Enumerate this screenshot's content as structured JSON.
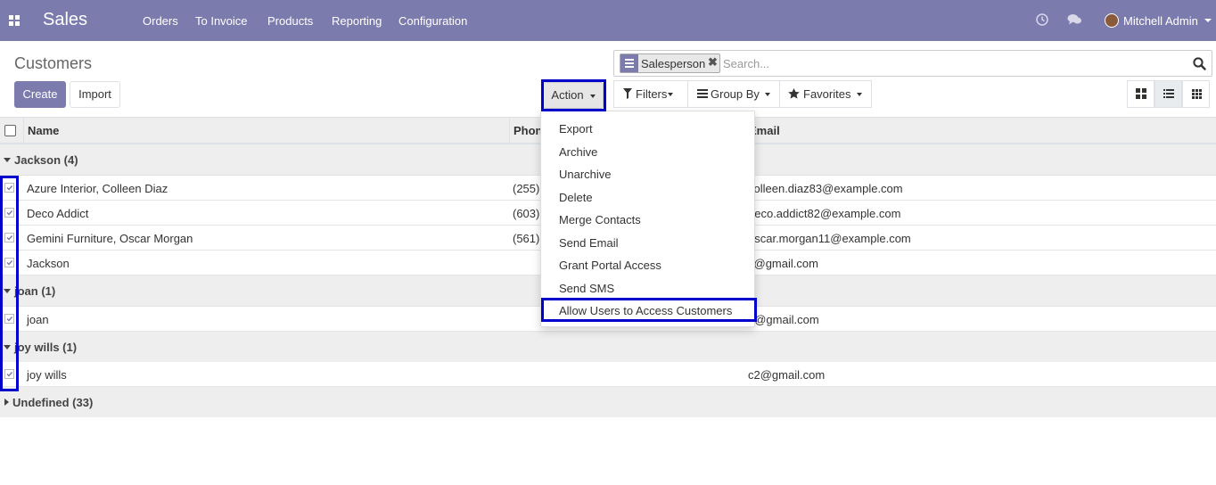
{
  "navbar": {
    "app_name": "Sales",
    "menu": [
      "Orders",
      "To Invoice",
      "Products",
      "Reporting",
      "Configuration"
    ],
    "user_name": "Mitchell Admin",
    "icons": [
      "apps-icon",
      "clock-icon",
      "chat-icon",
      "avatar"
    ]
  },
  "control_panel": {
    "title": "Customers",
    "create_label": "Create",
    "import_label": "Import",
    "action_label": "Action",
    "search": {
      "facet_label": "Salesperson",
      "facet_remove": "✖",
      "placeholder": "Search..."
    },
    "filters_label": "Filters",
    "group_by_label": "Group By",
    "favorites_label": "Favorites"
  },
  "table": {
    "columns": [
      "Name",
      "Phone",
      "Email"
    ],
    "groups": [
      {
        "label": "Jackson (4)",
        "expanded": true,
        "rows": [
          {
            "name": "Azure Interior, Colleen Diaz",
            "phone": "(255)-",
            "email": "colleen.diaz83@example.com"
          },
          {
            "name": "Deco Addict",
            "phone": "(603)-",
            "email": "deco.addict82@example.com"
          },
          {
            "name": "Gemini Furniture, Oscar Morgan",
            "phone": "(561)-",
            "email": "oscar.morgan11@example.com"
          },
          {
            "name": "Jackson",
            "phone": "",
            "email": "s@gmail.com"
          }
        ]
      },
      {
        "label": "joan (1)",
        "expanded": true,
        "rows": [
          {
            "name": "joan",
            "phone": "",
            "email": "4@gmail.com"
          }
        ]
      },
      {
        "label": "joy wills (1)",
        "expanded": true,
        "rows": [
          {
            "name": "joy wills",
            "phone": "",
            "email": "c2@gmail.com"
          }
        ]
      },
      {
        "label": "Undefined (33)",
        "expanded": false,
        "rows": []
      }
    ]
  },
  "action_menu": {
    "items": [
      "Export",
      "Archive",
      "Unarchive",
      "Delete",
      "Merge Contacts",
      "Send Email",
      "Grant Portal Access",
      "Send SMS",
      "Allow Users to Access Customers"
    ]
  },
  "colors": {
    "brand": "#7c7bad",
    "highlight": "#0000cc"
  }
}
